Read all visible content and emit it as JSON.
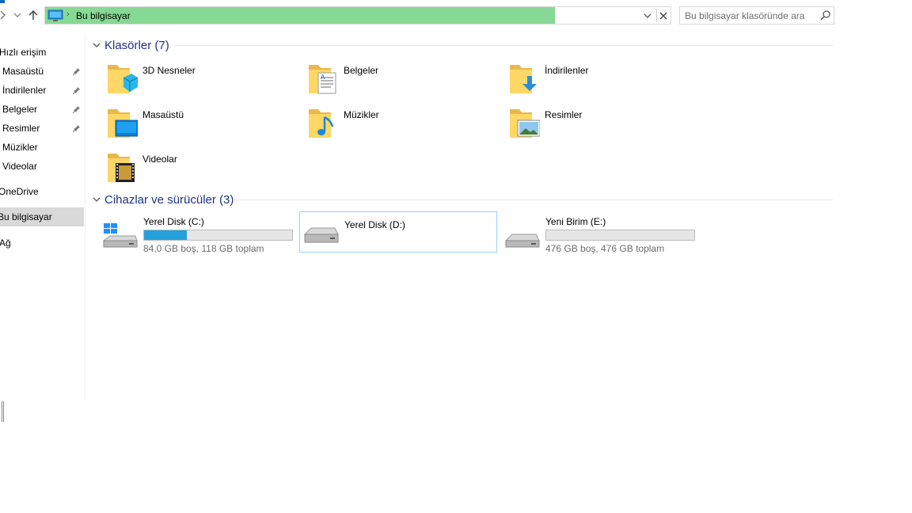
{
  "window": {
    "accent": "#0a64c8"
  },
  "address_bar": {
    "path": "Bu bilgisayar",
    "highlight": "#86d994"
  },
  "search": {
    "placeholder": "Bu bilgisayar klasöründe ara"
  },
  "sidebar": {
    "items": [
      {
        "label": "Hızlı erişim",
        "pinned": false
      },
      {
        "label": "Masaüstü",
        "pinned": true
      },
      {
        "label": "İndirilenler",
        "pinned": true
      },
      {
        "label": "Belgeler",
        "pinned": true
      },
      {
        "label": "Resimler",
        "pinned": true
      },
      {
        "label": "Müzikler",
        "pinned": false
      },
      {
        "label": "Videolar",
        "pinned": false
      },
      {
        "label": "OneDrive",
        "pinned": false
      },
      {
        "label": "Bu bilgisayar",
        "pinned": false,
        "active": true
      },
      {
        "label": "Ağ",
        "pinned": false
      }
    ]
  },
  "folders": {
    "title": "Klasörler (7)",
    "items": [
      {
        "label": "3D Nesneler",
        "icon": "3d-objects-folder-icon"
      },
      {
        "label": "Belgeler",
        "icon": "documents-folder-icon"
      },
      {
        "label": "İndirilenler",
        "icon": "downloads-folder-icon"
      },
      {
        "label": "Masaüstü",
        "icon": "desktop-folder-icon"
      },
      {
        "label": "Müzikler",
        "icon": "music-folder-icon"
      },
      {
        "label": "Resimler",
        "icon": "pictures-folder-icon"
      },
      {
        "label": "Videolar",
        "icon": "videos-folder-icon"
      }
    ]
  },
  "devices": {
    "title": "Cihazlar ve sürücüler (3)",
    "items": [
      {
        "label": "Yerel Disk (C:)",
        "info": "84,0 GB boş, 118 GB toplam",
        "used_fraction": 0.29,
        "has_bar": true,
        "system": true
      },
      {
        "label": "Yerel Disk (D:)",
        "info": "",
        "has_bar": false,
        "selected": true
      },
      {
        "label": "Yeni Birim (E:)",
        "info": "476 GB boş, 476 GB toplam",
        "used_fraction": 0.0,
        "has_bar": true
      }
    ]
  },
  "colors": {
    "section_title": "#1e3287",
    "bar_fill": "#26a0da",
    "selection_border": "#99d1ff"
  }
}
